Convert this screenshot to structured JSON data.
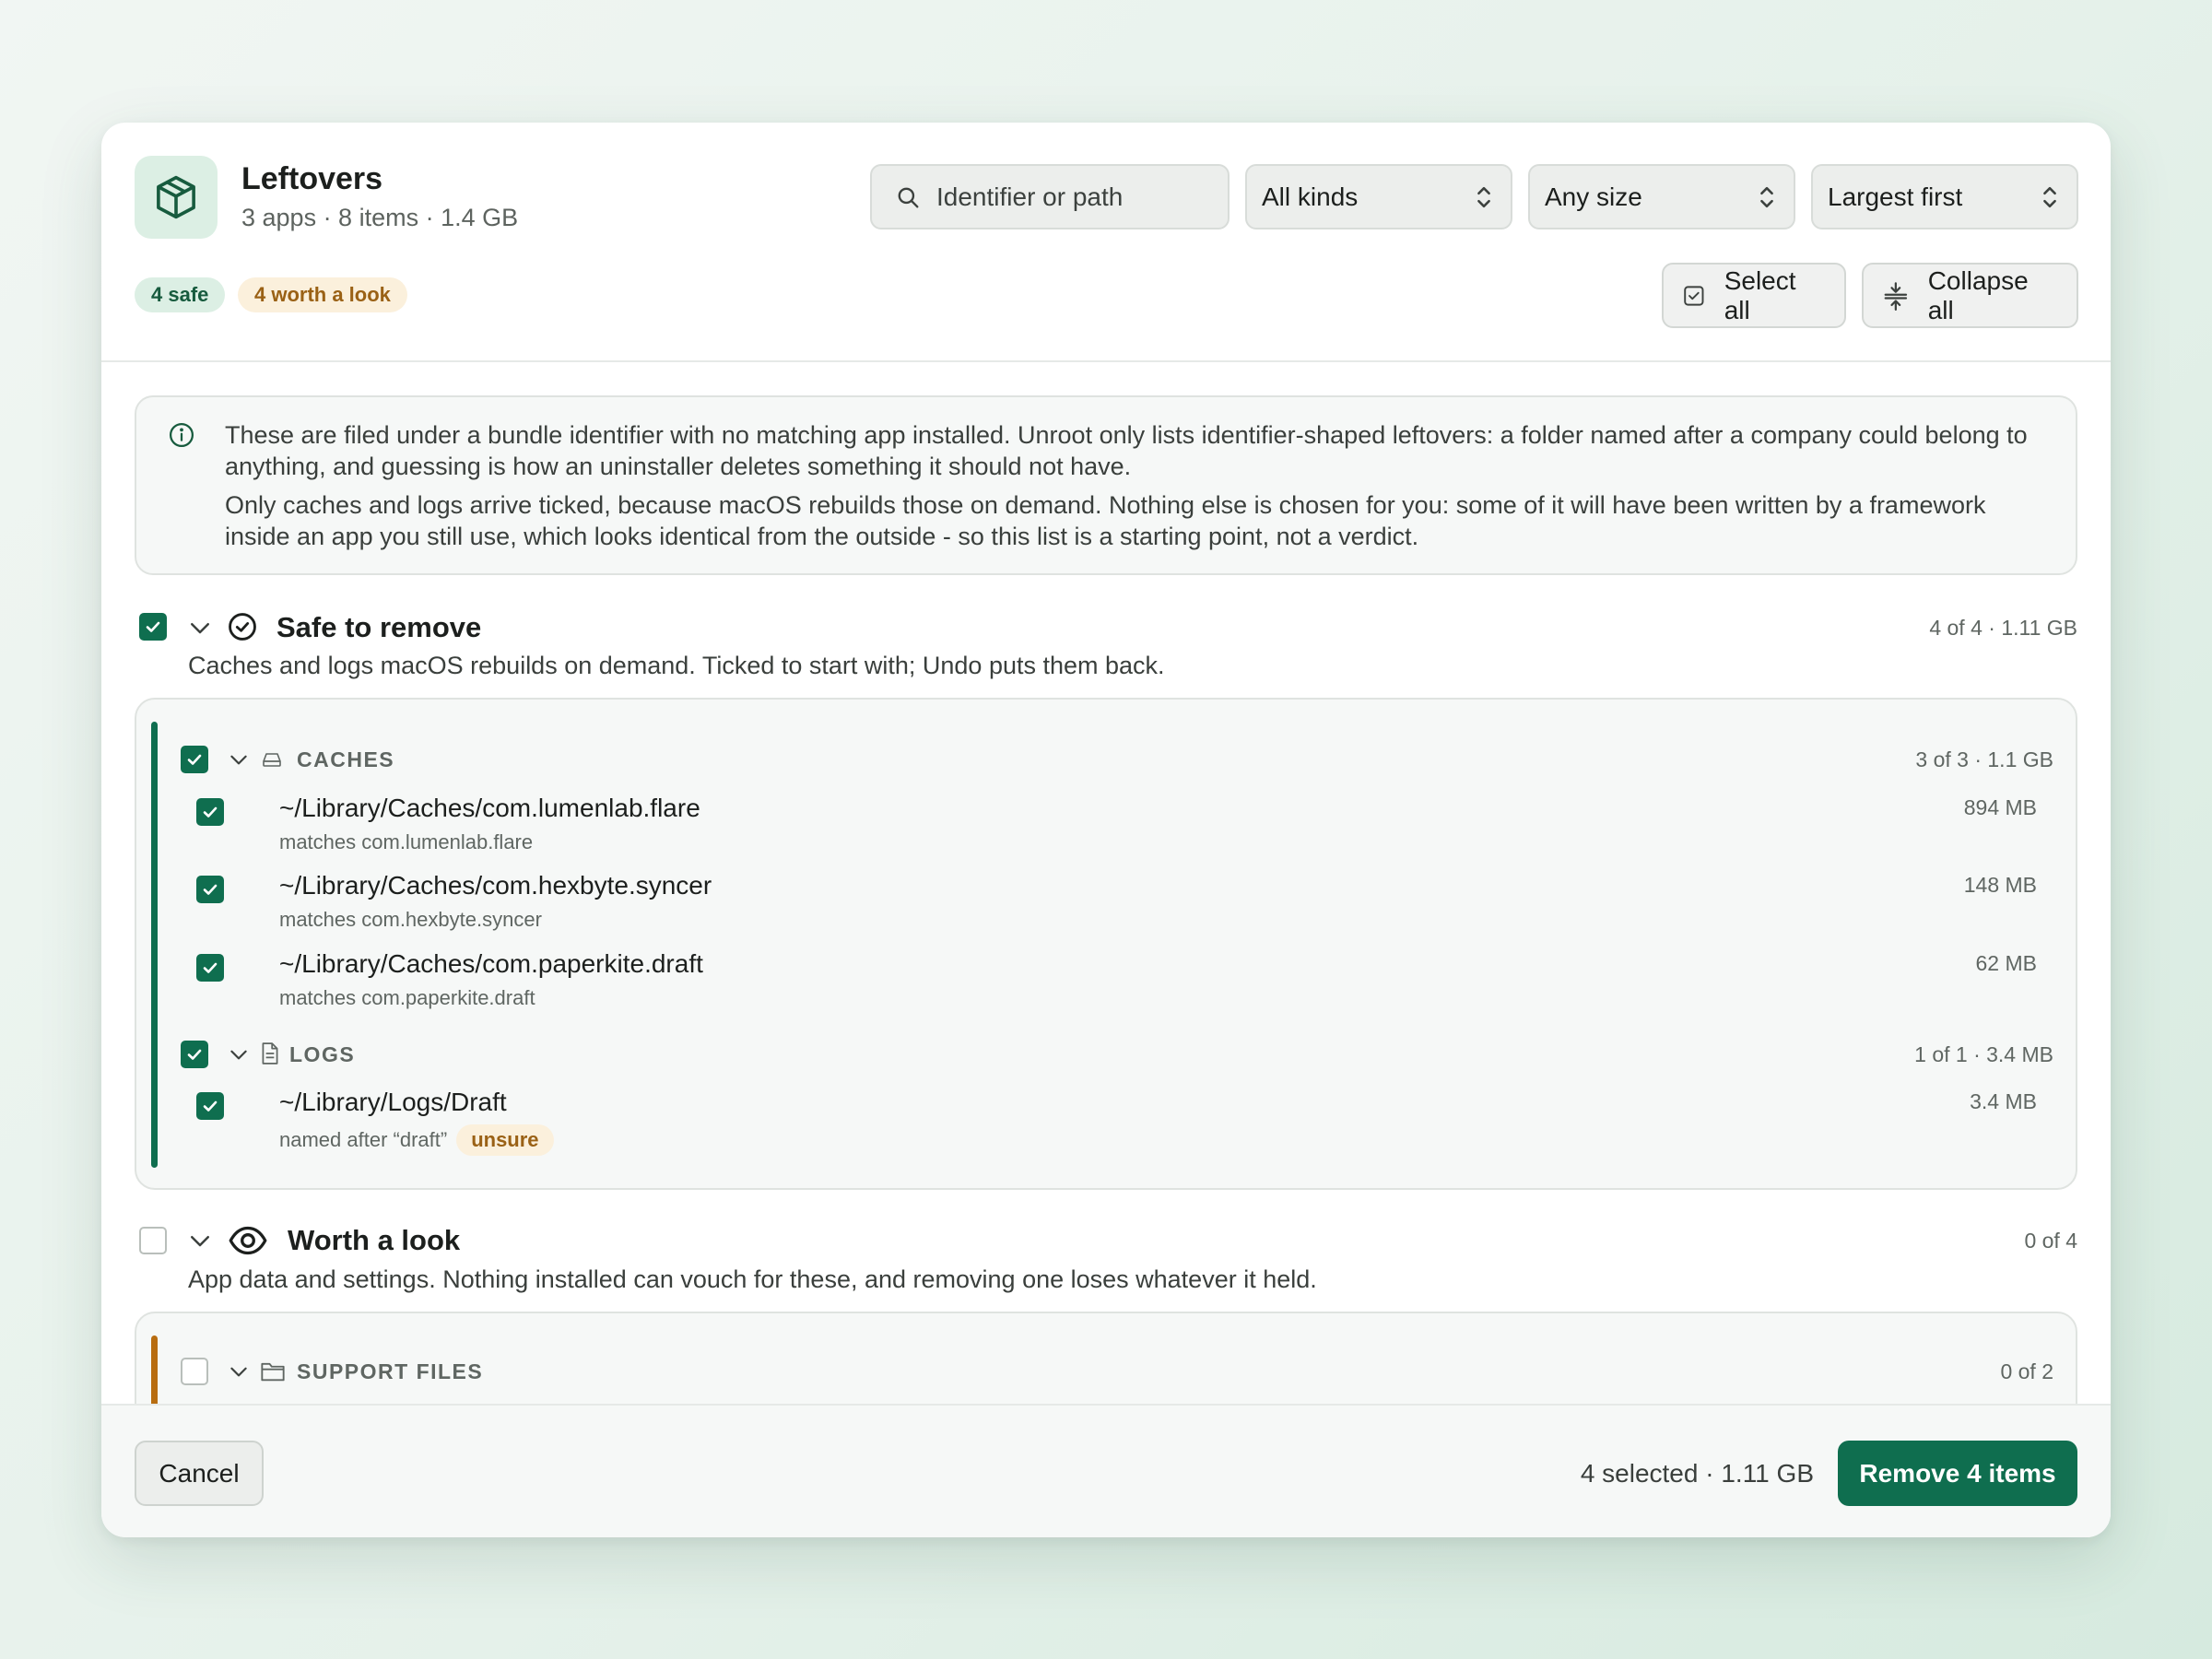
{
  "colors": {
    "accent_green": "#0f6e4f",
    "accent_amber": "#b86d10",
    "safe_badge_bg": "#dcefe4",
    "look_badge_bg": "#fbf0dc"
  },
  "header": {
    "icon": "package-icon",
    "title": "Leftovers",
    "subtitle": "3 apps · 8 items · 1.4 GB",
    "search_placeholder": "Identifier or path",
    "filters": {
      "kind": "All kinds",
      "size": "Any size",
      "sort": "Largest first"
    },
    "badges": {
      "safe": "4 safe",
      "look": "4 worth a look"
    },
    "select_all": "Select all",
    "collapse_all": "Collapse all"
  },
  "info": {
    "p1": "These are filed under a bundle identifier with no matching app installed. Unroot only lists identifier-shaped leftovers: a folder named after a company could belong to anything, and guessing is how an uninstaller deletes something it should not have.",
    "p2": "Only caches and logs arrive ticked, because macOS rebuilds those on demand. Nothing else is chosen for you: some of it will have been written by a framework inside an app you still use, which looks identical from the outside - so this list is a starting point, not a verdict."
  },
  "safe": {
    "title": "Safe to remove",
    "desc": "Caches and logs macOS rebuilds on demand. Ticked to start with; Undo puts them back.",
    "meta": "4 of 4 · 1.11 GB",
    "checked": true,
    "caches": {
      "label": "CACHES",
      "meta": "3 of 3 · 1.1 GB",
      "items": [
        {
          "path": "~/Library/Caches/com.lumenlab.flare",
          "sub": "matches com.lumenlab.flare",
          "size": "894 MB"
        },
        {
          "path": "~/Library/Caches/com.hexbyte.syncer",
          "sub": "matches com.hexbyte.syncer",
          "size": "148 MB"
        },
        {
          "path": "~/Library/Caches/com.paperkite.draft",
          "sub": "matches com.paperkite.draft",
          "size": "62 MB"
        }
      ]
    },
    "logs": {
      "label": "LOGS",
      "meta": "1 of 1 · 3.4 MB",
      "items": [
        {
          "path": "~/Library/Logs/Draft",
          "sub": "named after “draft”",
          "tag": "unsure",
          "size": "3.4 MB"
        }
      ]
    }
  },
  "look": {
    "title": "Worth a look",
    "desc": "App data and settings. Nothing installed can vouch for these, and removing one loses whatever it held.",
    "meta": "0 of 4",
    "checked": false,
    "support": {
      "label": "SUPPORT FILES",
      "meta": "0 of 2"
    }
  },
  "footer": {
    "cancel": "Cancel",
    "summary": "4 selected · 1.11 GB",
    "remove": "Remove 4 items"
  }
}
